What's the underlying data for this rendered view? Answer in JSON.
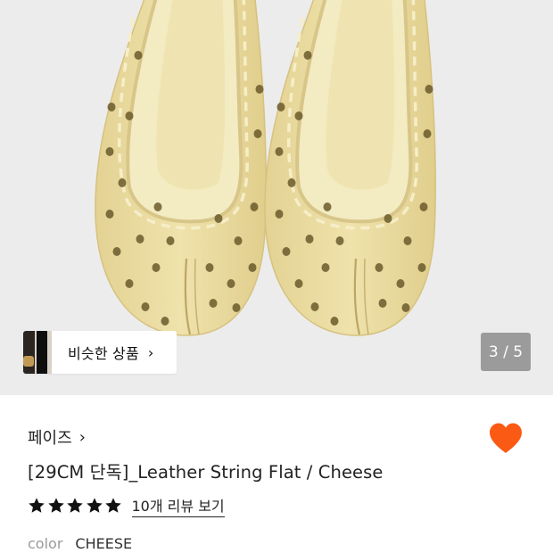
{
  "gallery": {
    "image_alt": "Leather String Flat shoes in cheese color, top view",
    "counter_text": "3 / 5"
  },
  "similar": {
    "label": "비슷한 상품",
    "chevron": "›"
  },
  "product": {
    "brand": "페이즈",
    "brand_chevron": "›",
    "title": "[29CM 단독]_Leather String Flat / Cheese",
    "rating_stars": 5,
    "review_link": "10개 리뷰 보기",
    "option_label": "color",
    "option_value": "CHEESE",
    "wishlisted": true
  },
  "colors": {
    "heart": "#fb5a14",
    "star": "#111111",
    "counter_bg": "rgba(90,90,90,0.55)",
    "hero_bg": "#ececec",
    "shoe": "#e9dba0"
  }
}
